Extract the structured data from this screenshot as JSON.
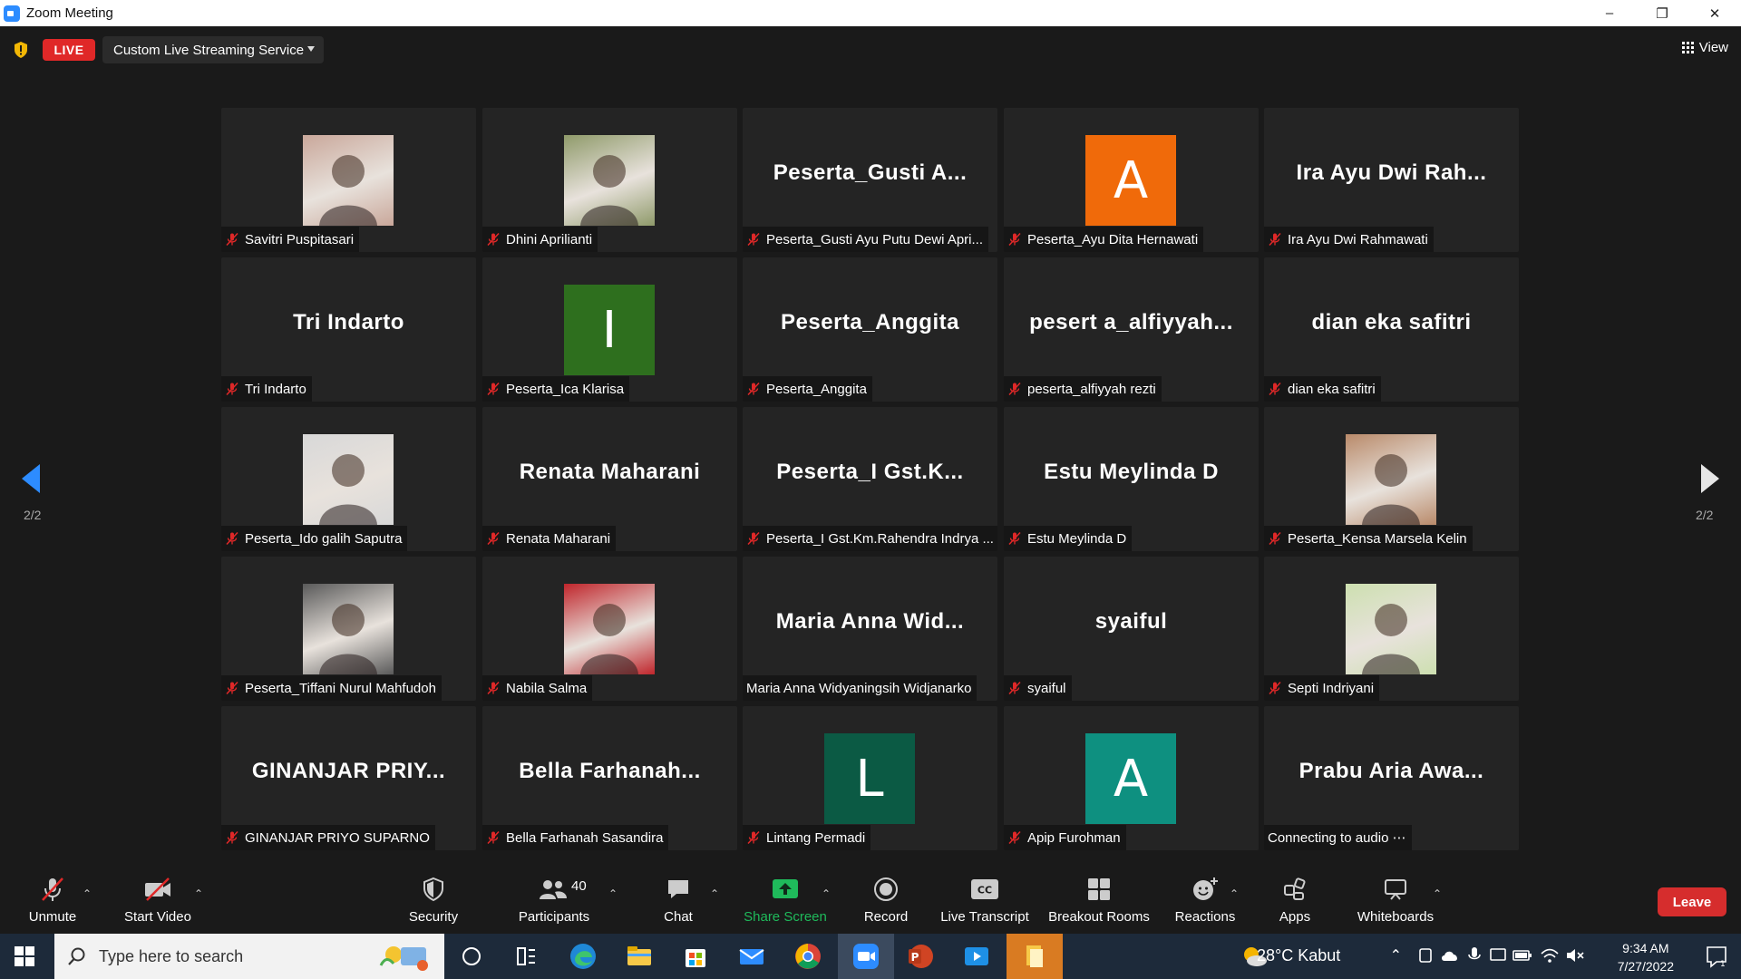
{
  "window": {
    "title": "Zoom Meeting",
    "controls": [
      "–",
      "❐",
      "✕"
    ]
  },
  "topbar": {
    "live_label": "LIVE",
    "stream_service": "Custom Live Streaming Service",
    "view_label": "View"
  },
  "colors": {
    "accent": "#2d8cff",
    "live": "#e02828",
    "leave": "#d62d2d",
    "share": "#1fba5b"
  },
  "pagination": {
    "left": "2/2",
    "right": "2/2"
  },
  "tiles": [
    {
      "big": "",
      "label": "Savitri Puspitasari",
      "muted": true,
      "avatar": "photo",
      "photo_color": "#c9a79a"
    },
    {
      "big": "",
      "label": "Dhini Aprilianti",
      "muted": true,
      "avatar": "photo",
      "photo_color": "#8f9a6a"
    },
    {
      "big": "Peserta_Gusti  A...",
      "label": "Peserta_Gusti Ayu Putu Dewi Apri...",
      "muted": true,
      "avatar": "none"
    },
    {
      "big": "",
      "label": "Peserta_Ayu Dita Hernawati",
      "muted": true,
      "avatar": "letter",
      "letter": "A",
      "color": "#f06a0a"
    },
    {
      "big": "Ira Ayu Dwi Rah...",
      "label": "Ira Ayu Dwi Rahmawati",
      "muted": true,
      "avatar": "none"
    },
    {
      "big": "Tri Indarto",
      "label": "Tri Indarto",
      "muted": true,
      "avatar": "none"
    },
    {
      "big": "",
      "label": "Peserta_Ica Klarisa",
      "muted": true,
      "avatar": "letter",
      "letter": "I",
      "color": "#2e6f1e"
    },
    {
      "big": "Peserta_Anggita",
      "label": "Peserta_Anggita",
      "muted": true,
      "avatar": "none"
    },
    {
      "big": "pesert a_alfiyyah...",
      "label": "peserta_alfiyyah rezti",
      "muted": true,
      "avatar": "none"
    },
    {
      "big": "dian eka safitri",
      "label": "dian eka safitri",
      "muted": true,
      "avatar": "none"
    },
    {
      "big": "",
      "label": "Peserta_Ido galih Saputra",
      "muted": true,
      "avatar": "photo",
      "photo_color": "#d8d8d8"
    },
    {
      "big": "Renata Maharani",
      "label": "Renata Maharani",
      "muted": true,
      "avatar": "none"
    },
    {
      "big": "Peserta_I  Gst.K...",
      "label": "Peserta_I Gst.Km.Rahendra Indrya ...",
      "muted": true,
      "avatar": "none"
    },
    {
      "big": "Estu Meylinda D",
      "label": "Estu Meylinda D",
      "muted": true,
      "avatar": "none"
    },
    {
      "big": "",
      "label": "Peserta_Kensa Marsela Kelin",
      "muted": true,
      "avatar": "photo",
      "photo_color": "#b98a6a"
    },
    {
      "big": "",
      "label": "Peserta_Tiffani Nurul Mahfudoh",
      "muted": true,
      "avatar": "photo",
      "photo_color": "#5a5a5a"
    },
    {
      "big": "",
      "label": "Nabila Salma",
      "muted": true,
      "avatar": "photo",
      "photo_color": "#c0262c"
    },
    {
      "big": "Maria  Anna  Wid...",
      "label": "Maria Anna Widyaningsih Widjanarko",
      "muted": false,
      "avatar": "none"
    },
    {
      "big": "syaiful",
      "label": "syaiful",
      "muted": true,
      "avatar": "none"
    },
    {
      "big": "",
      "label": "Septi Indriyani",
      "muted": true,
      "avatar": "photo",
      "photo_color": "#cde0b0"
    },
    {
      "big": "GINANJAR  PRIY...",
      "label": "GINANJAR PRIYO SUPARNO",
      "muted": true,
      "avatar": "none"
    },
    {
      "big": "Bella  Farhanah...",
      "label": "Bella Farhanah Sasandira",
      "muted": true,
      "avatar": "none"
    },
    {
      "big": "",
      "label": "Lintang Permadi",
      "muted": true,
      "avatar": "letter",
      "letter": "L",
      "color": "#0b5a44"
    },
    {
      "big": "",
      "label": "Apip Furohman",
      "muted": true,
      "avatar": "letter",
      "letter": "A",
      "color": "#0e9080"
    },
    {
      "big": "Prabu  Aria  Awa...",
      "label": "Connecting to audio ⋯",
      "muted": false,
      "avatar": "none"
    }
  ],
  "toolbar": {
    "unmute": "Unmute",
    "start_video": "Start Video",
    "security": "Security",
    "participants": "Participants",
    "participant_count": "40",
    "chat": "Chat",
    "share_screen": "Share Screen",
    "record": "Record",
    "live_transcript": "Live Transcript",
    "breakout_rooms": "Breakout Rooms",
    "reactions": "Reactions",
    "apps": "Apps",
    "whiteboards": "Whiteboards",
    "leave": "Leave"
  },
  "taskbar": {
    "search_placeholder": "Type here to search",
    "weather": "28°C  Kabut",
    "time": "9:34 AM",
    "date": "7/27/2022"
  }
}
